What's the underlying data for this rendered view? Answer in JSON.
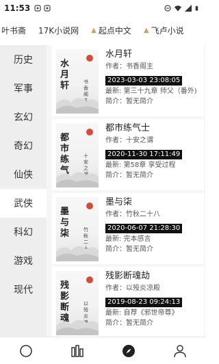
{
  "status_bar": {
    "time": "11:53",
    "left_icons": [
      "notification-icon",
      "notification-icon"
    ],
    "right_icons": [
      "minus-circle-icon",
      "wifi-icon",
      "signal-icon",
      "battery-icon"
    ]
  },
  "source_tabs": [
    {
      "label": "叶书斋",
      "icon": "",
      "active": false
    },
    {
      "label": "17K小说网",
      "icon": "",
      "active": false
    },
    {
      "label": "起点中文",
      "icon": "book-icon",
      "active": false
    },
    {
      "label": "飞卢小说",
      "icon": "book-icon",
      "active": false
    }
  ],
  "categories": [
    {
      "label": "历史",
      "active": false
    },
    {
      "label": "军事",
      "active": false
    },
    {
      "label": "玄幻",
      "active": false
    },
    {
      "label": "奇幻",
      "active": false
    },
    {
      "label": "仙侠",
      "active": false
    },
    {
      "label": "武侠",
      "active": true
    },
    {
      "label": "科幻",
      "active": false
    },
    {
      "label": "游戏",
      "active": false
    },
    {
      "label": "现代",
      "active": false
    }
  ],
  "books": [
    {
      "title": "水月轩",
      "cover_title": "水月轩",
      "cover_author": "书香阁主",
      "author": "作者：书香阁主",
      "time": "2023-03-03 23:08:05",
      "latest": "最新: 第三十九章 师父（番外)",
      "intro": "简介：暂无简介"
    },
    {
      "title": "都市练气士",
      "cover_title": "都市练气士",
      "cover_author": "十安之谓",
      "author": "作者：十安之谓",
      "time": "2020-11-30 17:11:49",
      "latest": "最新: 第58章 享受过程",
      "intro": "简介：暂无简介"
    },
    {
      "title": "墨与柒",
      "cover_title": "墨与柒",
      "cover_author": "竹秋二十八",
      "author": "作者：竹秋二十八",
      "time": "2020-06-07 21:28:30",
      "latest": "最新: 完本感言",
      "intro": "简介：暂无简介"
    },
    {
      "title": "残影断魂劫",
      "cover_title": "残影断魂劫",
      "cover_author": "以殁炎凉殿",
      "author": "作者：以殁炎凉殿",
      "time": "2019-08-23 09:24:13",
      "latest": "最新: 自荐《邪世帝尊》",
      "intro": "简介：暂无简介"
    }
  ],
  "bottom_nav": [
    {
      "icon": "circle-icon",
      "active": false
    },
    {
      "icon": "library-icon",
      "active": false
    },
    {
      "icon": "compass-icon",
      "active": true
    },
    {
      "icon": "person-icon",
      "active": false
    }
  ],
  "colors": {
    "sidebar_bg": "#eeeeee",
    "list_bg": "#f6f6f6",
    "time_badge_bg": "#111111",
    "cover_sun": "#d44b3a",
    "tab_icon": "#c9a063"
  }
}
